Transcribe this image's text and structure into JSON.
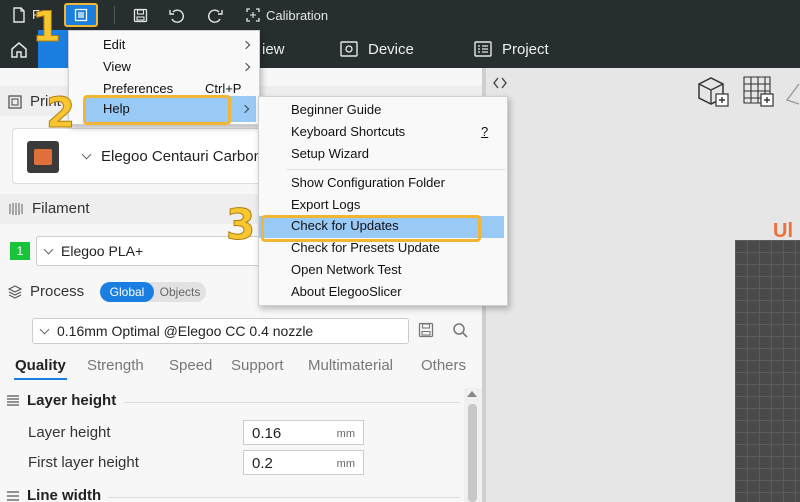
{
  "titlebar": {
    "file_label": "F",
    "calibration_label": "Calibration"
  },
  "tabs": {
    "view_partial": "iew",
    "device": "Device",
    "project": "Project"
  },
  "left": {
    "printer_section_partial": "Print",
    "printer_name": "Elegoo Centauri Carbon",
    "filament_title": "Filament",
    "filament_index": "1",
    "filament_name": "Elegoo PLA+",
    "process_title": "Process",
    "toggle_global": "Global",
    "toggle_objects": "Objects",
    "process_preset": "0.16mm Optimal @Elegoo CC 0.4 nozzle",
    "quality_tabs": [
      "Quality",
      "Strength",
      "Speed",
      "Support",
      "Multimaterial",
      "Others"
    ],
    "group_layer_height": "Layer height",
    "params": [
      {
        "label": "Layer height",
        "value": "0.16",
        "unit": "mm"
      },
      {
        "label": "First layer height",
        "value": "0.2",
        "unit": "mm"
      }
    ],
    "group_line_width": "Line width"
  },
  "main_menu": {
    "items": [
      {
        "label": "Edit"
      },
      {
        "label": "View"
      },
      {
        "label": "Preferences",
        "shortcut": "Ctrl+P"
      },
      {
        "label": "Help"
      }
    ]
  },
  "help_menu": {
    "items": [
      {
        "label": "Beginner Guide"
      },
      {
        "label": "Keyboard Shortcuts",
        "shortcut": "?"
      },
      {
        "label": "Setup Wizard"
      },
      {
        "label": "Show Configuration Folder"
      },
      {
        "label": "Export Logs"
      },
      {
        "label": "Check for Updates"
      },
      {
        "label": "Check for Presets Update"
      },
      {
        "label": "Open Network Test"
      },
      {
        "label": "About ElegooSlicer"
      }
    ]
  },
  "annotations": {
    "step1": "1",
    "step2": "2",
    "step3": "3"
  },
  "right": {
    "brand_partial": "Ul"
  },
  "colors": {
    "accent": "#1a7fe0",
    "highlight_box": "#f2b632",
    "menu_highlight": "#99c9f5",
    "dark_bar": "#262e30",
    "brand_orange": "#f0703a",
    "filament_green": "#17c43a"
  }
}
